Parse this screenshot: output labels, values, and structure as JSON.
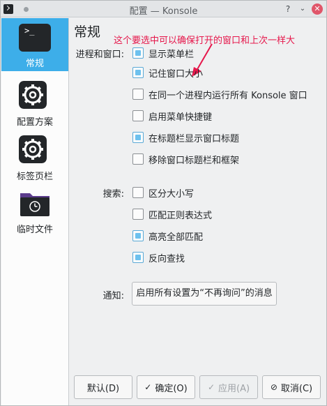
{
  "window": {
    "title": "配置 — Konsole",
    "help_icon": "?",
    "chevron_icon": "⌄",
    "close_icon": "✕"
  },
  "sidebar": {
    "items": [
      {
        "label": "常规",
        "icon": "terminal-icon",
        "active": true
      },
      {
        "label": "配置方案",
        "icon": "gear-icon",
        "active": false
      },
      {
        "label": "标签页栏",
        "icon": "gear-icon",
        "active": false
      },
      {
        "label": "临时文件",
        "icon": "folder-clock-icon",
        "active": false
      }
    ]
  },
  "page": {
    "title": "常规",
    "annotation": "这个要选中可以确保打开的窗口和上次一样大"
  },
  "groups": {
    "process_window": {
      "label": "进程和窗口:",
      "options": [
        {
          "label": "显示菜单栏",
          "checked": true
        },
        {
          "label": "记住窗口大小",
          "checked": true
        },
        {
          "label": "在同一个进程内运行所有 Konsole 窗口",
          "checked": false
        },
        {
          "label": "启用菜单快捷键",
          "checked": false
        },
        {
          "label": "在标题栏显示窗口标题",
          "checked": true
        },
        {
          "label": "移除窗口标题栏和框架",
          "checked": false
        }
      ]
    },
    "search": {
      "label": "搜索:",
      "options": [
        {
          "label": "区分大小写",
          "checked": false
        },
        {
          "label": "匹配正则表达式",
          "checked": false
        },
        {
          "label": "高亮全部匹配",
          "checked": true
        },
        {
          "label": "反向查找",
          "checked": true
        }
      ]
    },
    "notify": {
      "label": "通知:",
      "button": "启用所有设置为“不再询问”的消息"
    }
  },
  "buttons": {
    "defaults": "默认(D)",
    "ok": "确定(O)",
    "apply": "应用(A)",
    "cancel": "取消(C)",
    "ok_icon": "✓",
    "apply_icon": "✓",
    "cancel_icon": "⊘"
  },
  "colors": {
    "accent": "#3daee9",
    "annotation": "#e6174b"
  }
}
